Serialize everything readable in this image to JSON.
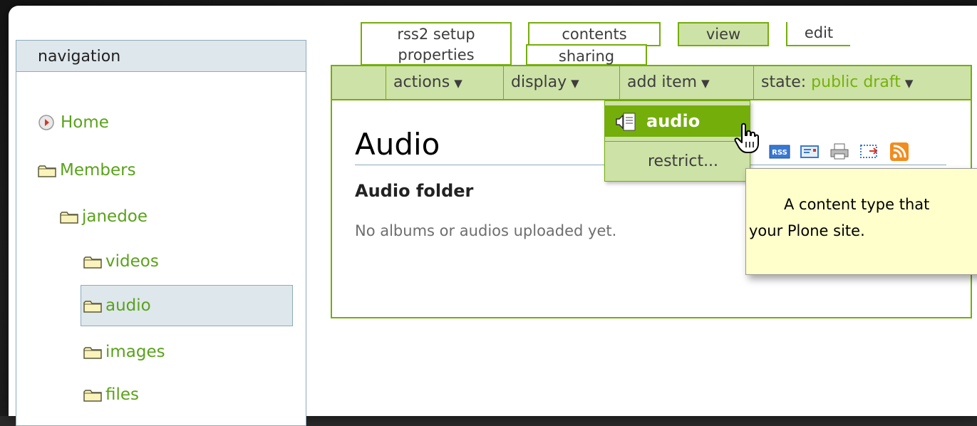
{
  "tabs": {
    "row1": [
      {
        "id": "rss2",
        "label": "rss2 setup"
      },
      {
        "id": "contents",
        "label": "contents"
      },
      {
        "id": "view",
        "label": "view",
        "selected": true
      },
      {
        "id": "edit",
        "label": "edit"
      }
    ],
    "row2": [
      {
        "id": "properties",
        "label": "properties"
      },
      {
        "id": "sharing",
        "label": "sharing"
      }
    ]
  },
  "menubar": {
    "actions": "actions",
    "display": "display",
    "add_item": "add item",
    "state_label": "state:",
    "state_value": "public draft"
  },
  "navigation": {
    "title": "navigation",
    "items": [
      {
        "label": "Home",
        "icon": "home-icon"
      },
      {
        "label": "Members",
        "icon": "folder-icon"
      },
      {
        "label": "janedoe",
        "icon": "folder-icon"
      },
      {
        "label": "videos",
        "icon": "folder-icon"
      },
      {
        "label": "audio",
        "icon": "folder-icon",
        "selected": true
      },
      {
        "label": "images",
        "icon": "folder-icon"
      },
      {
        "label": "files",
        "icon": "folder-icon"
      }
    ]
  },
  "content": {
    "title": "Audio",
    "description": "Audio folder",
    "body": "No albums or audios uploaded yet."
  },
  "doc_actions": [
    "rss-icon",
    "mail-icon",
    "print-icon",
    "fullscreen-icon",
    "feed-icon"
  ],
  "dropdown": {
    "item_label": "audio",
    "restrict_label": "restrict..."
  },
  "tooltip": {
    "line1": "A content type that",
    "line2": "your Plone site."
  },
  "colors": {
    "accent_green": "#74ae0b",
    "light_green": "#cde2a7",
    "link_green": "#5aa21a",
    "nav_blue": "#dee7ec",
    "tooltip_yellow": "#ffffcc"
  }
}
